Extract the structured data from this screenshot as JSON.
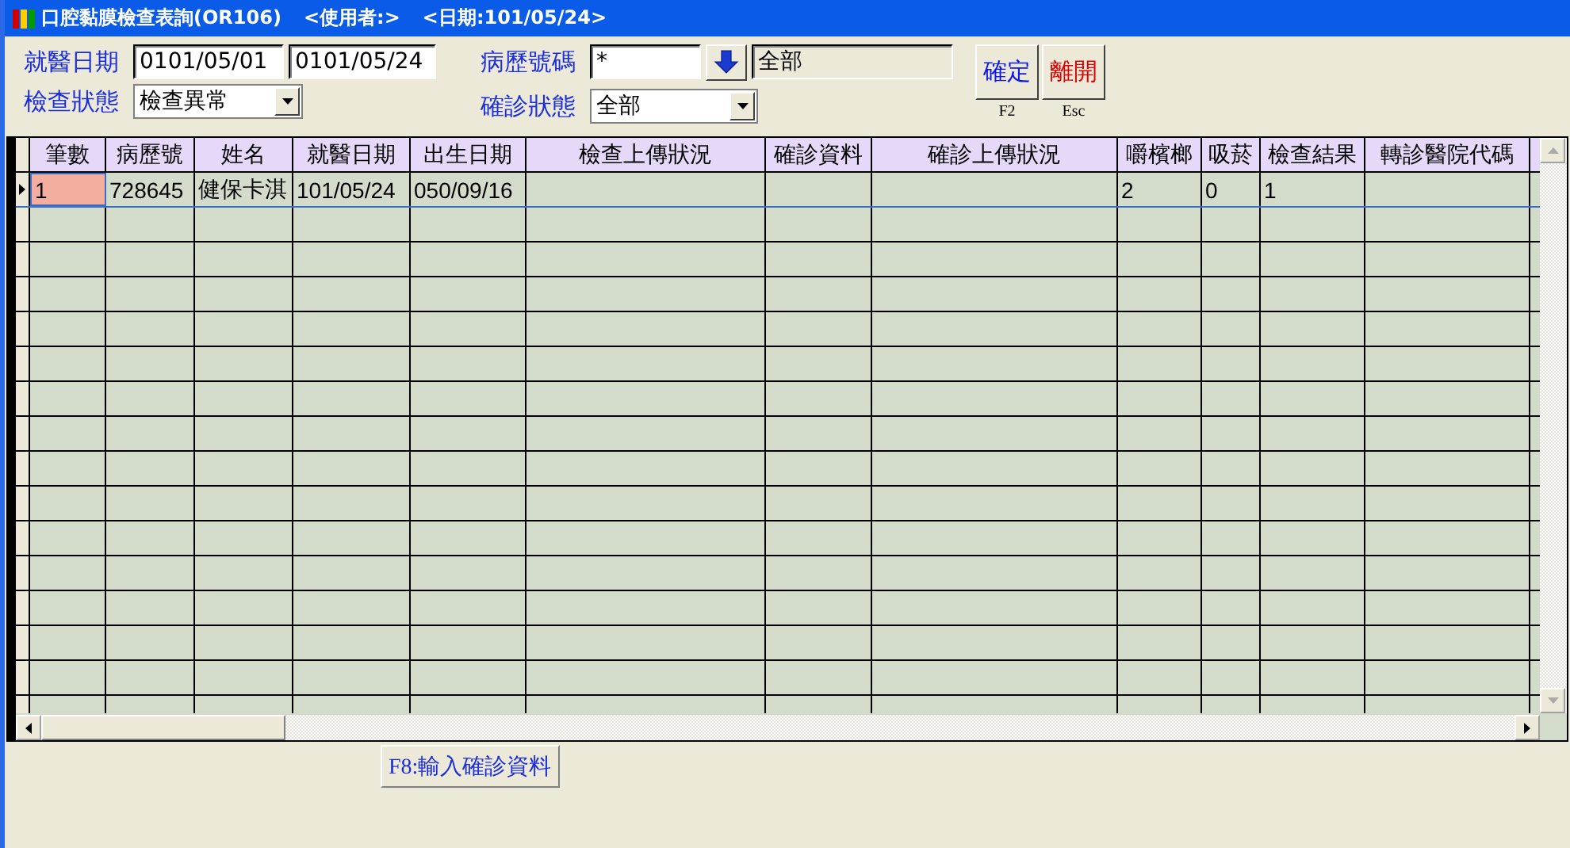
{
  "window": {
    "title": "口腔黏膜檢查表詢(OR106)",
    "user": "<使用者:>",
    "date": "<日期:101/05/24>"
  },
  "filters": {
    "visit_date_label": "就醫日期",
    "visit_date_from": "0101/05/01",
    "visit_date_to": "0101/05/24",
    "exam_status_label": "檢查狀態",
    "exam_status": "檢查異常",
    "chart_no_label": "病歷號碼",
    "chart_no": "*",
    "chart_no_result": "全部",
    "confirm_status_label": "確診狀態",
    "confirm_status": "全部"
  },
  "buttons": [
    {
      "label": "確定",
      "shortcut": "F2",
      "kind": "ok"
    },
    {
      "label": "離開",
      "shortcut": "Esc",
      "kind": "exit"
    }
  ],
  "table": {
    "columns": [
      "筆數",
      "病歷號",
      "姓名",
      "就醫日期",
      "出生日期",
      "檢查上傳狀況",
      "確診資料",
      "確診上傳狀況",
      "嚼檳榔",
      "吸菸",
      "檢查結果",
      "轉診醫院代碼"
    ],
    "rows": [
      {
        "selected": true,
        "cells": [
          "1",
          "728645",
          "健保卡淇",
          "101/05/24",
          "050/09/16",
          "",
          "",
          "",
          "2",
          "0",
          "1",
          ""
        ]
      }
    ]
  },
  "action_button": "F8:輸入確診資料"
}
